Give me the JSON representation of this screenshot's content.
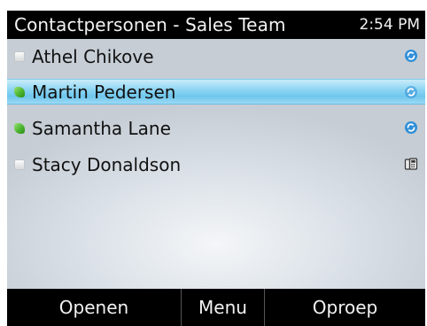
{
  "header": {
    "title": "Contactpersonen - Sales Team",
    "time": "2:54 PM"
  },
  "contacts": [
    {
      "name": "Athel Chikove",
      "status": "offline",
      "icon": "communicator-icon",
      "selected": false
    },
    {
      "name": "Martin Pedersen",
      "status": "online",
      "icon": "communicator-icon",
      "selected": true
    },
    {
      "name": "Samantha Lane",
      "status": "online",
      "icon": "communicator-icon",
      "selected": false
    },
    {
      "name": "Stacy Donaldson",
      "status": "offline",
      "icon": "phone-icon",
      "selected": false
    }
  ],
  "softkeys": {
    "left": "Openen",
    "middle": "Menu",
    "right": "Oproep"
  },
  "colors": {
    "bar_background": "#000000",
    "selection": "#8fd6f3",
    "online": "#4cb52e",
    "communicator_icon": "#2f8fd8"
  }
}
